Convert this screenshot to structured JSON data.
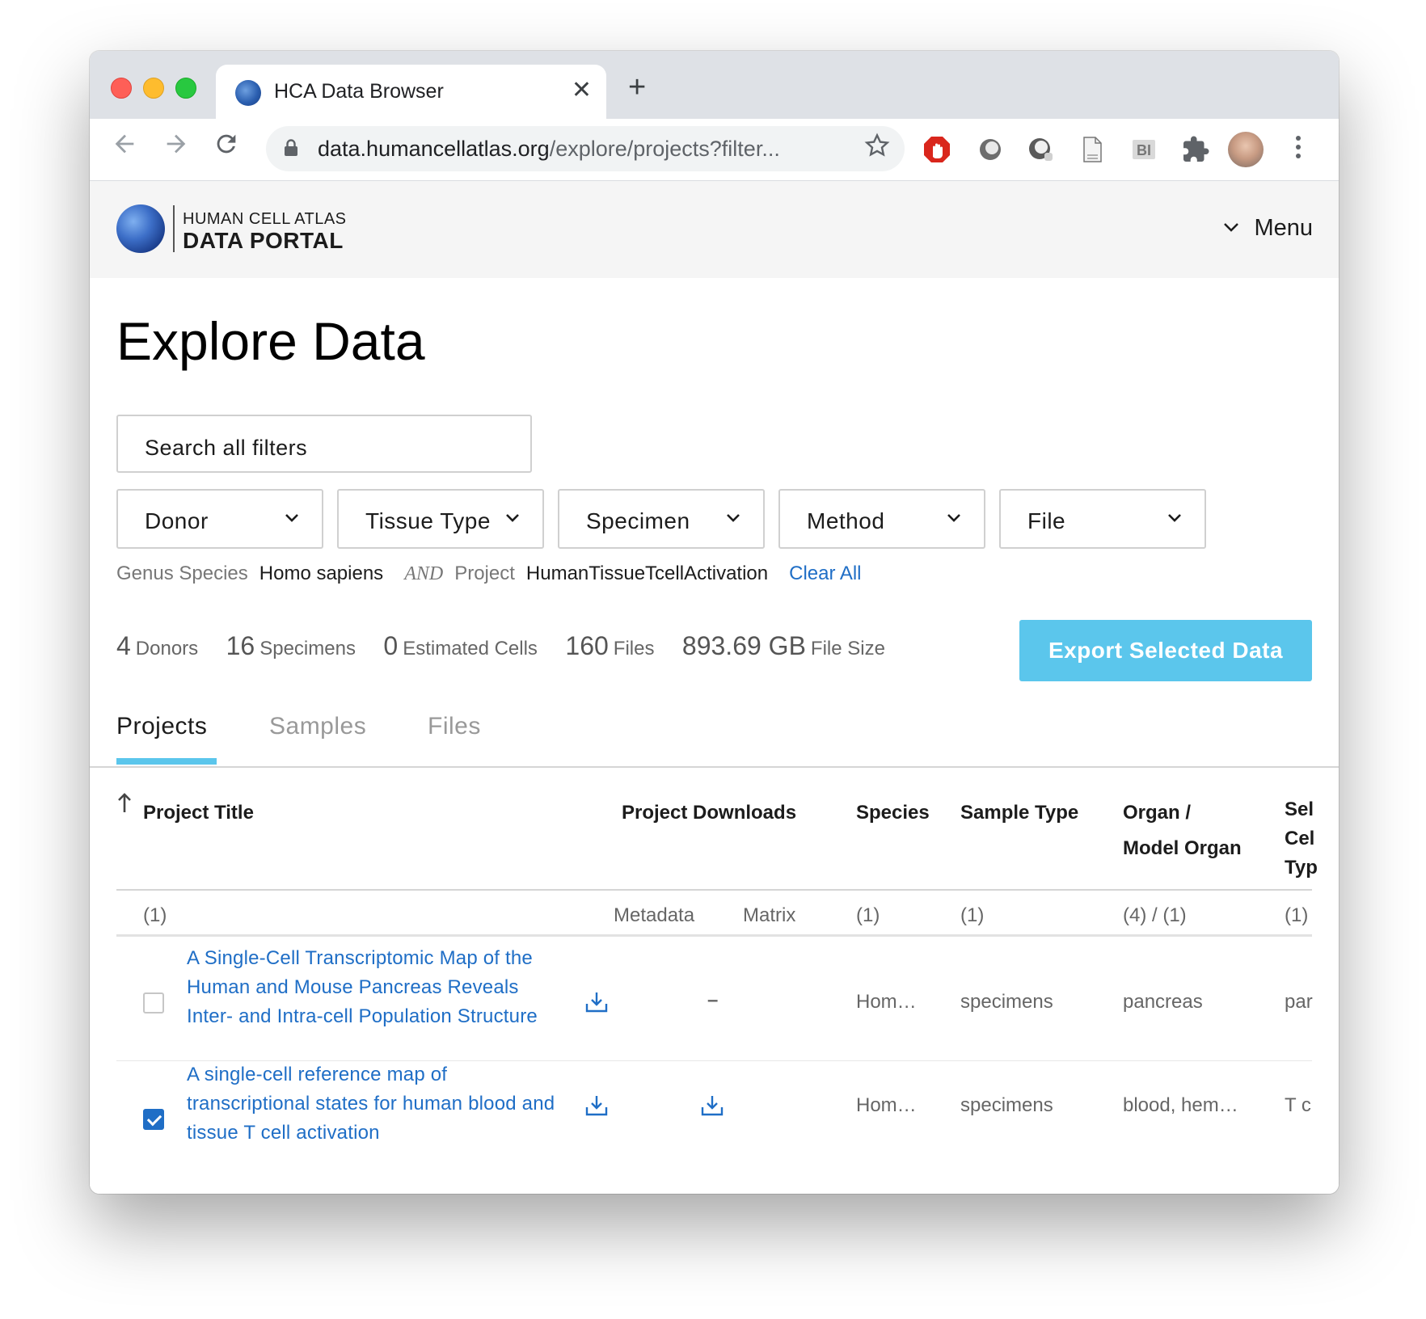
{
  "browser": {
    "tab_title": "HCA Data Browser",
    "tab_close": "✕",
    "new_tab": "+",
    "url_host": "data.humancellatlas.org",
    "url_rest": "/explore/projects?filter...",
    "icons": [
      "back-arrow-icon",
      "forward-arrow-icon",
      "reload-icon",
      "lock-icon",
      "star-icon",
      "stop-hand-extension-icon",
      "circle-extension-icon",
      "search-extension-icon",
      "document-extension-icon",
      "bi-extension-icon",
      "puzzle-extension-icon",
      "kebab-menu-icon"
    ]
  },
  "site": {
    "logo_line1": "HUMAN CELL ATLAS",
    "logo_line2": "DATA PORTAL",
    "menu_label": "Menu"
  },
  "page": {
    "title": "Explore Data",
    "search_placeholder": "Search all filters"
  },
  "filters": [
    "Donor",
    "Tissue Type",
    "Specimen",
    "Method",
    "File"
  ],
  "selected": {
    "key1": "Genus Species",
    "val1": "Homo sapiens",
    "and": "AND",
    "key2": "Project",
    "val2": "HumanTissueTcellActivation",
    "clear": "Clear All"
  },
  "stats": [
    {
      "num": "4",
      "label": "Donors"
    },
    {
      "num": "16",
      "label": "Specimens"
    },
    {
      "num": "0",
      "label": "Estimated Cells"
    },
    {
      "num": "160",
      "label": "Files"
    },
    {
      "num": "893.69 GB",
      "label": "File Size"
    }
  ],
  "export_label": "Export Selected Data",
  "tabs": [
    "Projects",
    "Samples",
    "Files"
  ],
  "active_tab": "Projects",
  "table": {
    "headers": {
      "title": "Project Title",
      "downloads": "Project Downloads",
      "species": "Species",
      "sample": "Sample Type",
      "organ_line1": "Organ /",
      "organ_line2": "Model Organ",
      "cell_line1": "Sel",
      "cell_line2": "Cel",
      "cell_line3": "Typ"
    },
    "subheader": {
      "count": "(1)",
      "metadata": "Metadata",
      "matrix": "Matrix",
      "species": "(1)",
      "sample": "(1)",
      "organ": "(4) / (1)",
      "cell": "(1)"
    },
    "rows": [
      {
        "checked": false,
        "title": "A Single-Cell Transcriptomic Map of the Human and Mouse Pancreas Reveals Inter- and Intra-cell Population Structure",
        "matrix": "–",
        "species": "Hom…",
        "sample": "specimens",
        "organ": "pancreas",
        "cell": "par"
      },
      {
        "checked": true,
        "title": "A single-cell reference map of transcriptional states for human blood and tissue T cell activation",
        "species": "Hom…",
        "sample": "specimens",
        "organ": "blood, hem…",
        "cell": "T c"
      }
    ]
  },
  "colors": {
    "accent": "#5bc6ec",
    "link": "#1f6ec6",
    "header_bg": "#f5f5f5"
  }
}
